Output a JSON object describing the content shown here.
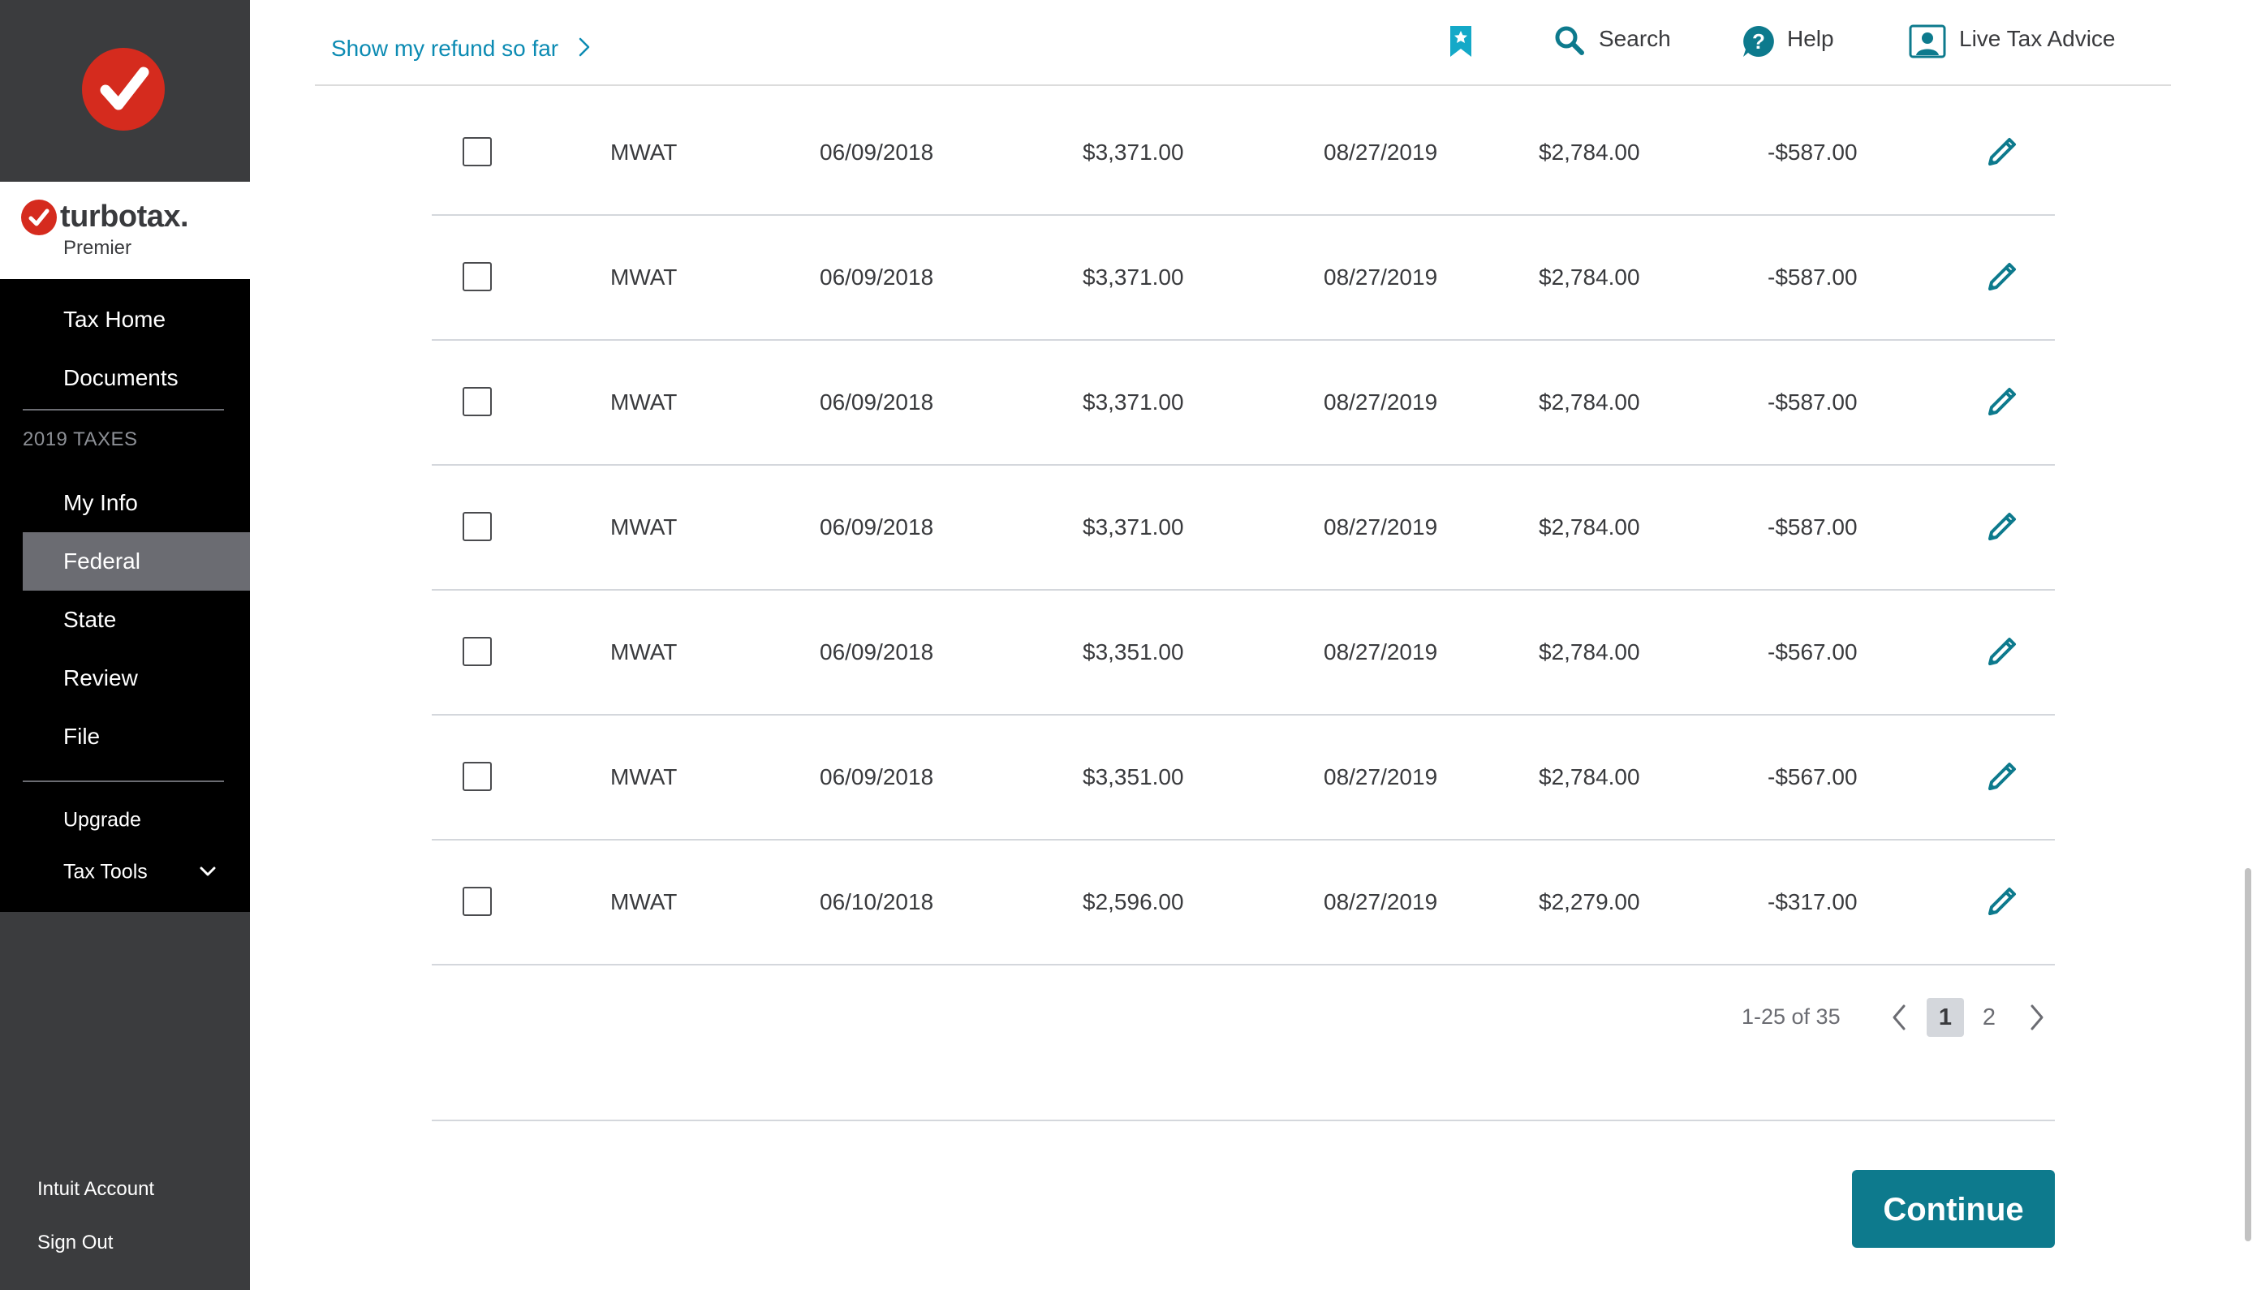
{
  "brand": {
    "name": "turbotax",
    "name_dot": ".",
    "edition": "Premier",
    "color": "#d52b1e"
  },
  "sidebar": {
    "items": [
      {
        "label": "Tax Home"
      },
      {
        "label": "Documents"
      }
    ],
    "section_label": "2019 TAXES",
    "tax_items": [
      {
        "label": "My Info"
      },
      {
        "label": "Federal",
        "active": true
      },
      {
        "label": "State"
      },
      {
        "label": "Review"
      },
      {
        "label": "File"
      }
    ],
    "upgrade_label": "Upgrade",
    "tax_tools_label": "Tax Tools",
    "footer": {
      "intuit_account": "Intuit Account",
      "sign_out": "Sign Out"
    }
  },
  "header": {
    "refund_link": "Show my refund so far",
    "search_label": "Search",
    "help_label": "Help",
    "live_advice_label": "Live Tax Advice",
    "accent": "#0c8bb3"
  },
  "table": {
    "rows": [
      {
        "name": "MWAT",
        "date_acquired": "06/09/2018",
        "cost": "$3,371.00",
        "date_sold": "08/27/2019",
        "proceeds": "$2,784.00",
        "gain": "-$587.00"
      },
      {
        "name": "MWAT",
        "date_acquired": "06/09/2018",
        "cost": "$3,371.00",
        "date_sold": "08/27/2019",
        "proceeds": "$2,784.00",
        "gain": "-$587.00"
      },
      {
        "name": "MWAT",
        "date_acquired": "06/09/2018",
        "cost": "$3,371.00",
        "date_sold": "08/27/2019",
        "proceeds": "$2,784.00",
        "gain": "-$587.00"
      },
      {
        "name": "MWAT",
        "date_acquired": "06/09/2018",
        "cost": "$3,371.00",
        "date_sold": "08/27/2019",
        "proceeds": "$2,784.00",
        "gain": "-$587.00"
      },
      {
        "name": "MWAT",
        "date_acquired": "06/09/2018",
        "cost": "$3,351.00",
        "date_sold": "08/27/2019",
        "proceeds": "$2,784.00",
        "gain": "-$567.00"
      },
      {
        "name": "MWAT",
        "date_acquired": "06/09/2018",
        "cost": "$3,351.00",
        "date_sold": "08/27/2019",
        "proceeds": "$2,784.00",
        "gain": "-$567.00"
      },
      {
        "name": "MWAT",
        "date_acquired": "06/10/2018",
        "cost": "$2,596.00",
        "date_sold": "08/27/2019",
        "proceeds": "$2,279.00",
        "gain": "-$317.00"
      }
    ]
  },
  "pagination": {
    "range": "1-25 of 35",
    "pages": [
      "1",
      "2"
    ],
    "current": "1"
  },
  "continue_label": "Continue",
  "colors": {
    "sidebar_bg": "#3b3c3e",
    "nav_bg": "#000000",
    "active_bg": "#6b6c72",
    "edit_icon": "#0d7a8d",
    "continue_bg": "#0d7a8d"
  }
}
